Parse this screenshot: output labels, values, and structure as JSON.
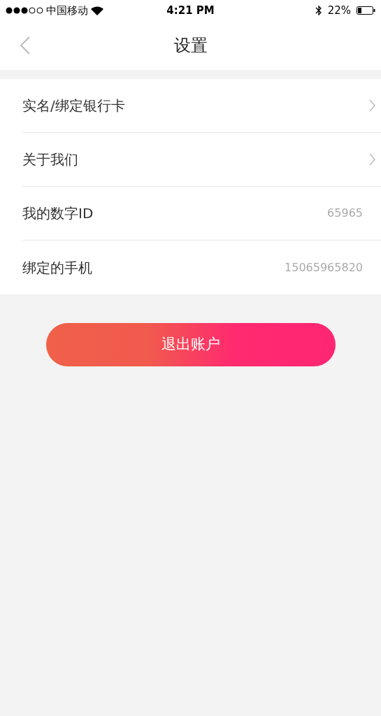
{
  "status_bar": {
    "carrier": "中国移动",
    "time": "4:21 PM",
    "battery": "22%"
  },
  "nav": {
    "title": "设置"
  },
  "rows": [
    {
      "kind": "link",
      "label": "实名/绑定银行卡"
    },
    {
      "kind": "link",
      "label": "关于我们"
    },
    {
      "kind": "value",
      "label": "我的数字ID",
      "value": "65965"
    },
    {
      "kind": "value",
      "label": "绑定的手机",
      "value": "15065965820"
    }
  ],
  "logout_button": {
    "label": "退出账户"
  }
}
